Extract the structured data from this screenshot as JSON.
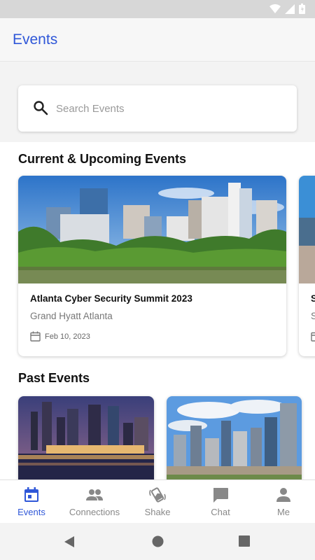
{
  "app_bar": {
    "title": "Events"
  },
  "search": {
    "placeholder": "Search Events",
    "value": ""
  },
  "sections": {
    "current_title": "Current & Upcoming Events",
    "past_title": "Past Events"
  },
  "current_events": [
    {
      "title": "Atlanta Cyber Security Summit 2023",
      "venue": "Grand Hyatt Atlanta",
      "date": "Feb 10, 2023"
    },
    {
      "title": "S",
      "venue": "S",
      "date": ""
    }
  ],
  "bottom_nav": {
    "items": [
      {
        "label": "Events",
        "icon": "calendar-icon",
        "active": true
      },
      {
        "label": "Connections",
        "icon": "people-icon",
        "active": false
      },
      {
        "label": "Shake",
        "icon": "shake-phone-icon",
        "active": false
      },
      {
        "label": "Chat",
        "icon": "chat-bubble-icon",
        "active": false
      },
      {
        "label": "Me",
        "icon": "person-icon",
        "active": false
      }
    ]
  },
  "colors": {
    "accent": "#2f57d8",
    "nav_inactive": "#888888"
  }
}
